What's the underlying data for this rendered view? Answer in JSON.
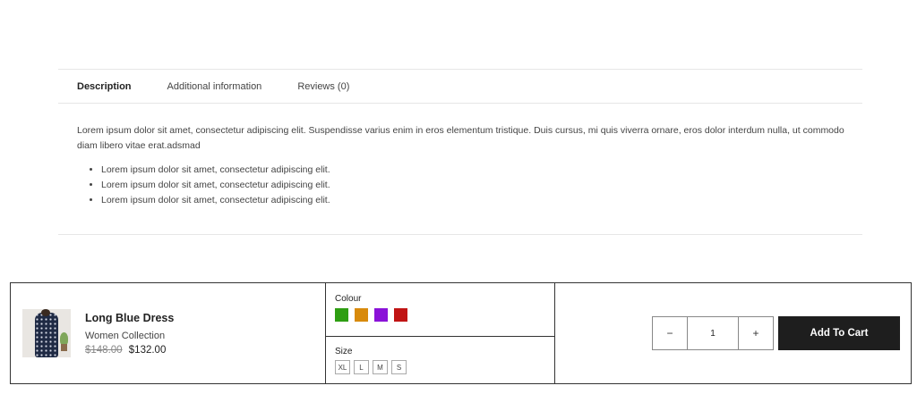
{
  "tabs": [
    {
      "label": "Description"
    },
    {
      "label": "Additional information"
    },
    {
      "label": "Reviews (0)"
    }
  ],
  "description": {
    "text": "Lorem ipsum dolor sit amet, consectetur adipiscing elit. Suspendisse varius enim in eros elementum tristique. Duis cursus, mi quis viverra ornare, eros dolor interdum nulla, ut commodo diam libero vitae erat.adsmad",
    "bullets": [
      "Lorem ipsum dolor sit amet, consectetur adipiscing elit.",
      "Lorem ipsum dolor sit amet, consectetur adipiscing elit.",
      "Lorem ipsum dolor sit amet, consectetur adipiscing elit."
    ]
  },
  "product": {
    "name": "Long Blue Dress",
    "collection": "Women Collection",
    "old_price": "$148.00",
    "price": "$132.00"
  },
  "options": {
    "colour_label": "Colour",
    "colours": [
      "#2e9e12",
      "#d88a0c",
      "#8a12d8",
      "#c01414"
    ],
    "size_label": "Size",
    "sizes": [
      "XL",
      "L",
      "M",
      "S"
    ]
  },
  "cart": {
    "minus": "−",
    "quantity": "1",
    "plus": "+",
    "add_label": "Add To Cart"
  }
}
